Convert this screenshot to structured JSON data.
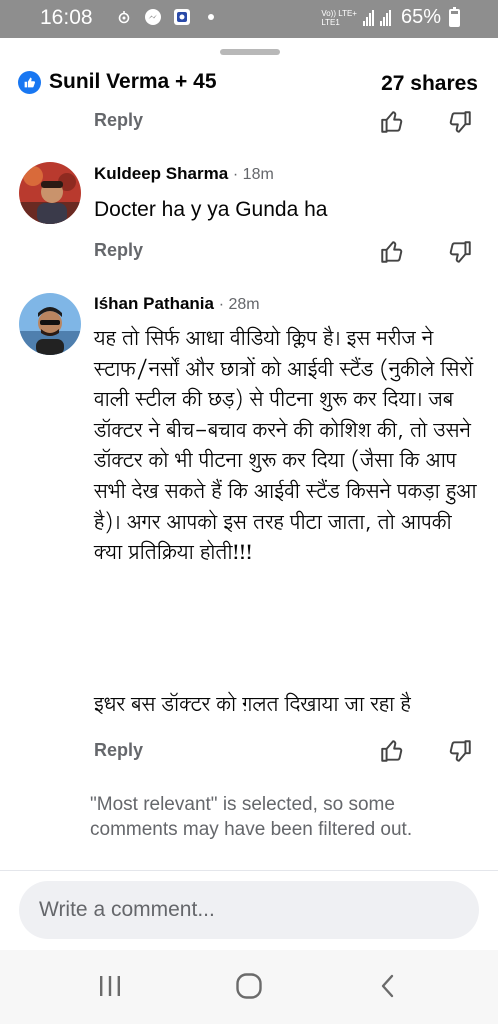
{
  "status_bar": {
    "time": "16:08",
    "network": "Vo)) LTE+",
    "network2": "LTE1",
    "battery_pct": "65%",
    "icons": [
      "notification-icon",
      "messenger-icon",
      "app-icon",
      "dot-icon",
      "signal-icon",
      "battery-icon"
    ]
  },
  "reactions": {
    "text": "Sunil Verma + 45",
    "shares": "27 shares",
    "reply_label": "Reply",
    "icon": "like-badge-icon"
  },
  "comments": [
    {
      "author": "Kuldeep Sharma",
      "time": "· 18m",
      "text": "Docter ha y ya Gunda ha",
      "reply_label": "Reply"
    },
    {
      "author": "Iśhan Pathania",
      "time": "· 28m",
      "text": "यह तो सिर्फ आधा वीडियो क्लिप है। इस मरीज ने स्टाफ/नर्सों और छात्रों को आईवी स्टैंड (नुकीले सिरों वाली स्टील की छड़) से पीटना शुरू कर दिया। जब डॉक्टर ने बीच-बचाव करने की कोशिश की, तो उसने डॉक्टर को भी पीटना शुरू कर दिया (जैसा कि आप सभी देख सकते हैं कि आईवी स्टैंड किसने पकड़ा हुआ है)। अगर आपको इस तरह पीटा जाता, तो आपकी क्या प्रतिक्रिया होती!!!",
      "text2": "इधर बस डॉक्टर को ग़लत दिखाया जा रहा है",
      "reply_label": "Reply"
    }
  ],
  "filter_note": "\"Most relevant\" is selected, so some comments may have been filtered out.",
  "composer": {
    "placeholder": "Write a comment..."
  },
  "colors": {
    "accent": "#1877f2",
    "secondary_text": "#65676b",
    "status_bar": "#8e8e8e"
  }
}
